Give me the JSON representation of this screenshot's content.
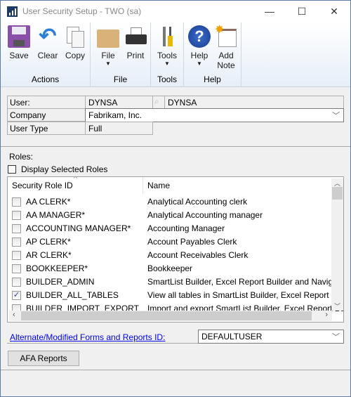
{
  "window": {
    "title": "User Security Setup  -  TWO (sa)",
    "minimize": "—",
    "maximize": "☐",
    "close": "✕"
  },
  "ribbon": {
    "groups": [
      {
        "name": "Actions",
        "buttons": [
          {
            "label": "Save",
            "icon": "floppy-disk-icon"
          },
          {
            "label": "Clear",
            "icon": "undo-arrow-icon"
          },
          {
            "label": "Copy",
            "icon": "copy-documents-icon"
          }
        ]
      },
      {
        "name": "File",
        "buttons": [
          {
            "label": "File",
            "icon": "folder-icon",
            "dropdown": "▼"
          },
          {
            "label": "Print",
            "icon": "printer-icon"
          }
        ]
      },
      {
        "name": "Tools",
        "buttons": [
          {
            "label": "Tools",
            "icon": "wrench-screwdriver-icon",
            "dropdown": "▼"
          }
        ]
      },
      {
        "name": "Help",
        "buttons": [
          {
            "label": "Help",
            "icon": "question-icon",
            "dropdown": "▼"
          },
          {
            "label": "Add Note",
            "icon": "note-icon"
          }
        ]
      }
    ]
  },
  "form": {
    "user_label": "User:",
    "user_id": "DYNSA",
    "user_name": "DYNSA",
    "company_label": "Company",
    "company_value": "Fabrikam, Inc.",
    "user_type_label": "User Type",
    "user_type_value": "Full",
    "roles_label": "Roles:",
    "display_selected_label": "Display Selected Roles"
  },
  "grid": {
    "columns": [
      "Security Role ID",
      "Name"
    ],
    "sort_indicator": "^",
    "rows": [
      {
        "id": "AA CLERK*",
        "name": "Analytical Accounting clerk",
        "checked": false
      },
      {
        "id": "AA MANAGER*",
        "name": "Analytical Accounting manager",
        "checked": false
      },
      {
        "id": "ACCOUNTING MANAGER*",
        "name": "Accounting Manager",
        "checked": false
      },
      {
        "id": "AP CLERK*",
        "name": "Account Payables Clerk",
        "checked": false
      },
      {
        "id": "AR CLERK*",
        "name": "Account Receivables Clerk",
        "checked": false
      },
      {
        "id": "BOOKKEEPER*",
        "name": "Bookkeeper",
        "checked": false
      },
      {
        "id": "BUILDER_ADMIN",
        "name": "SmartList Builder, Excel Report Builder and Navigation",
        "checked": false
      },
      {
        "id": "BUILDER_ALL_TABLES",
        "name": "View all tables in SmartList Builder, Excel Report Builder",
        "checked": true
      },
      {
        "id": "BUILDER_IMPORT_EXPORT",
        "name": "Import and export SmartList Builder, Excel Report Builder",
        "checked": false
      }
    ],
    "check_glyph": "✓"
  },
  "footer": {
    "alt_forms_link": "Alternate/Modified Forms and Reports ID:",
    "alt_forms_value": "DEFAULTUSER",
    "afa_button": "AFA Reports"
  },
  "colors": {
    "link": "#0000ee",
    "border": "#5a7ea8"
  }
}
